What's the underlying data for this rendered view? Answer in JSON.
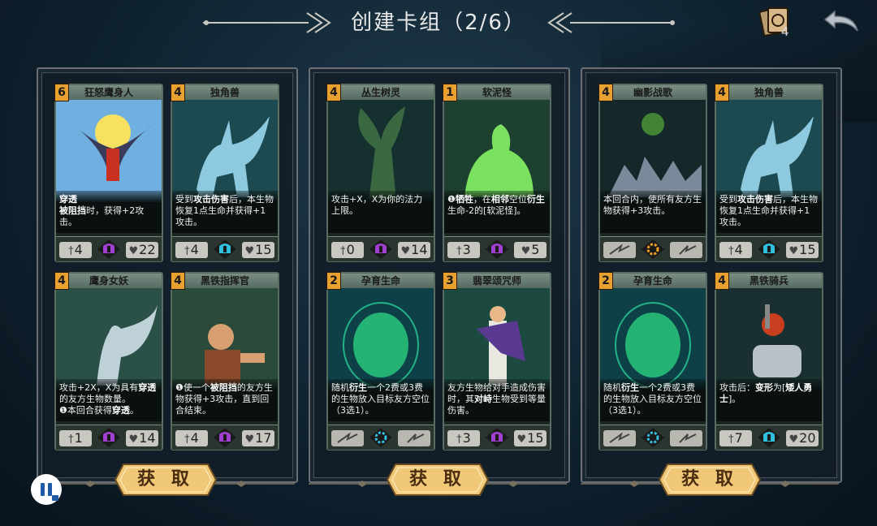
{
  "header": {
    "title": "创建卡组（2/6）",
    "deck_count": "4"
  },
  "panels": [
    {
      "button_label": "获 取",
      "cards": [
        {
          "cost": "6",
          "name": "狂怒鹰身人",
          "desc_html": "<b>穿透</b><br><b>被阻挡</b>时，获得+2攻击。",
          "atk": "4",
          "hp": "22",
          "mid_icon": "helmet-purple",
          "art": "harpy"
        },
        {
          "cost": "4",
          "name": "独角兽",
          "desc_html": "受到<b>攻击伤害</b>后，本生物恢复1点生命并获得+1攻击。",
          "atk": "4",
          "hp": "15",
          "mid_icon": "helmet-cyan",
          "art": "unicorn"
        },
        {
          "cost": "4",
          "name": "鹰身女妖",
          "desc_html": "攻击+2X，X为具有<b>穿透</b>的友方生物数量。<br>❶本回合获得<b>穿透</b>。",
          "atk": "1",
          "hp": "14",
          "mid_icon": "helmet-purple",
          "art": "harpy-woman"
        },
        {
          "cost": "4",
          "name": "黑铁指挥官",
          "desc_html": "❶使一个<b>被阻挡</b>的友方生物获得+3攻击，直到回合结束。",
          "atk": "4",
          "hp": "17",
          "mid_icon": "helmet-purple",
          "art": "dwarf"
        }
      ]
    },
    {
      "button_label": "获 取",
      "cards": [
        {
          "cost": "4",
          "name": "丛生树灵",
          "desc_html": "攻击+X，X为你的法力上限。",
          "atk": "0",
          "hp": "14",
          "mid_icon": "helmet-purple",
          "art": "treant"
        },
        {
          "cost": "1",
          "name": "软泥怪",
          "desc_html": "❶<b>牺牲</b>，在<b>相邻</b>空位<b>衍生</b>生命-2的[软泥怪]。",
          "atk": "3",
          "hp": "5",
          "mid_icon": "helmet-purple",
          "art": "slime"
        },
        {
          "cost": "2",
          "name": "孕育生命",
          "desc_html": "随机<b>衍生</b>一个2费或3费的生物放入目标友方空位（3选1）。",
          "atk": "",
          "hp": "",
          "mid_icon": "gear-cyan",
          "art": "egg"
        },
        {
          "cost": "3",
          "name": "翡翠颂咒师",
          "desc_html": "友方生物给对手造成伤害时，其<b>对峙</b>生物受到等量伤害。",
          "atk": "3",
          "hp": "15",
          "mid_icon": "helmet-purple",
          "art": "mage"
        }
      ]
    },
    {
      "button_label": "获 取",
      "cards": [
        {
          "cost": "4",
          "name": "幽影战歌",
          "desc_html": "本回合内，使所有友方生物获得+3攻击。",
          "atk": "",
          "hp": "",
          "mid_icon": "sun-orange",
          "art": "wolves"
        },
        {
          "cost": "4",
          "name": "独角兽",
          "desc_html": "受到<b>攻击伤害</b>后，本生物恢复1点生命并获得+1攻击。",
          "atk": "4",
          "hp": "15",
          "mid_icon": "helmet-cyan",
          "art": "unicorn"
        },
        {
          "cost": "2",
          "name": "孕育生命",
          "desc_html": "随机<b>衍生</b>一个2费或3费的生物放入目标友方空位（3选1）。",
          "atk": "",
          "hp": "",
          "mid_icon": "gear-cyan",
          "art": "egg"
        },
        {
          "cost": "4",
          "name": "黑铁骑兵",
          "desc_html": "攻击后：<b>变形</b>为[<b>矮人勇士</b>]。",
          "atk": "7",
          "hp": "20",
          "mid_icon": "helmet-cyan",
          "art": "rider"
        }
      ]
    }
  ],
  "icons": {
    "deck": "deck-cards-icon",
    "back": "back-arrow-icon",
    "pause": "pause-icon"
  },
  "colors": {
    "cost_bg": "#e8a030",
    "button_gold": "#f0c878",
    "purple": "#a040d0",
    "cyan": "#30c0e0"
  }
}
